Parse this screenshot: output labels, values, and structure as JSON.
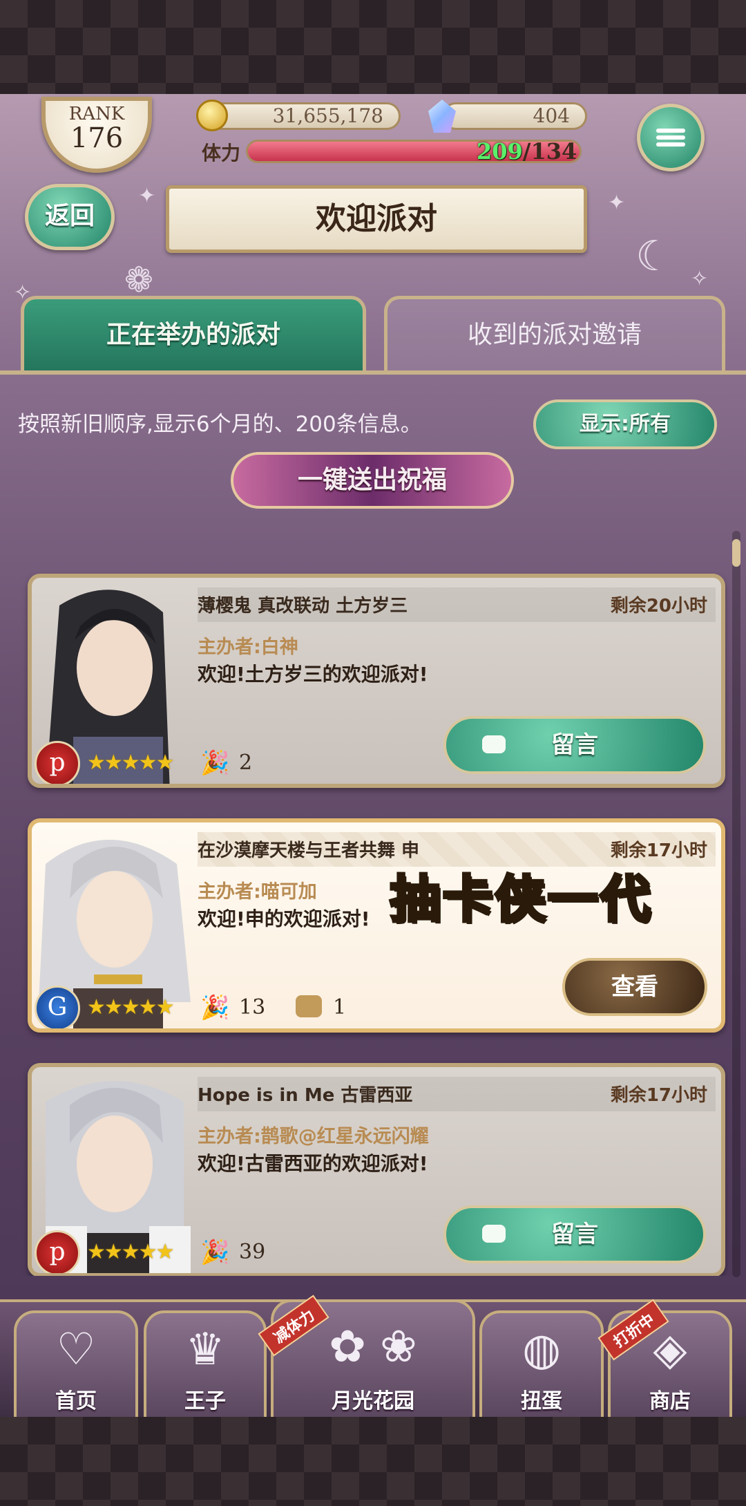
{
  "hud": {
    "rank_label": "RANK",
    "rank_value": "176",
    "coins": "31,655,178",
    "gems": "404",
    "stamina_label": "体力",
    "stamina_current": "209",
    "stamina_max": "/134",
    "stamina_fill_fraction": 1.0
  },
  "header": {
    "back_label": "返回",
    "title": "欢迎派对"
  },
  "tabs": [
    {
      "label": "正在举办的派对",
      "active": true
    },
    {
      "label": "收到的派对邀请",
      "active": false
    }
  ],
  "info_text": "按照新旧顺序,显示6个月的、200条信息。",
  "filter_label": "显示:所有",
  "bless_label": "一键送出祝福",
  "cards": [
    {
      "event": "薄樱鬼 真改联动 土方岁三",
      "remaining": "剩余20小时",
      "host": "主办者:白神",
      "welcome": "欢迎!土方岁三的欢迎派对!",
      "badge": "p",
      "stars": "★★★★★",
      "poppers": "2",
      "comments": "",
      "button": "留言"
    },
    {
      "event": "在沙漠摩天楼与王者共舞 申",
      "remaining": "剩余17小时",
      "host": "主办者:喵可加",
      "welcome": "欢迎!申的欢迎派对!",
      "badge": "G",
      "stars": "★★★★★",
      "poppers": "13",
      "comments": "1",
      "button": "查看"
    },
    {
      "event": "Hope is in Me 古雷西亚",
      "remaining": "剩余17小时",
      "host": "主办者:鹊歌@红星永远闪耀",
      "welcome": "欢迎!古雷西亚的欢迎派对!",
      "badge": "p",
      "stars": "★★★★★",
      "poppers": "39",
      "comments": "",
      "button": "留言"
    }
  ],
  "overlay_caption": "抽卡侠一代",
  "nav": [
    {
      "label": "首页",
      "icon": "heart-icon"
    },
    {
      "label": "王子",
      "icon": "crown-icon"
    },
    {
      "label": "月光花园",
      "icon": "garden-icon",
      "ribbon": "减体力"
    },
    {
      "label": "扭蛋",
      "icon": "gacha-icon"
    },
    {
      "label": "商店",
      "icon": "shop-icon",
      "ribbon": "打折中"
    }
  ],
  "colors": {
    "accent_green": "#24866a",
    "frame_gold": "#bda57a",
    "stamina_red": "#c8334d",
    "stamina_current_green": "#5af06a"
  }
}
